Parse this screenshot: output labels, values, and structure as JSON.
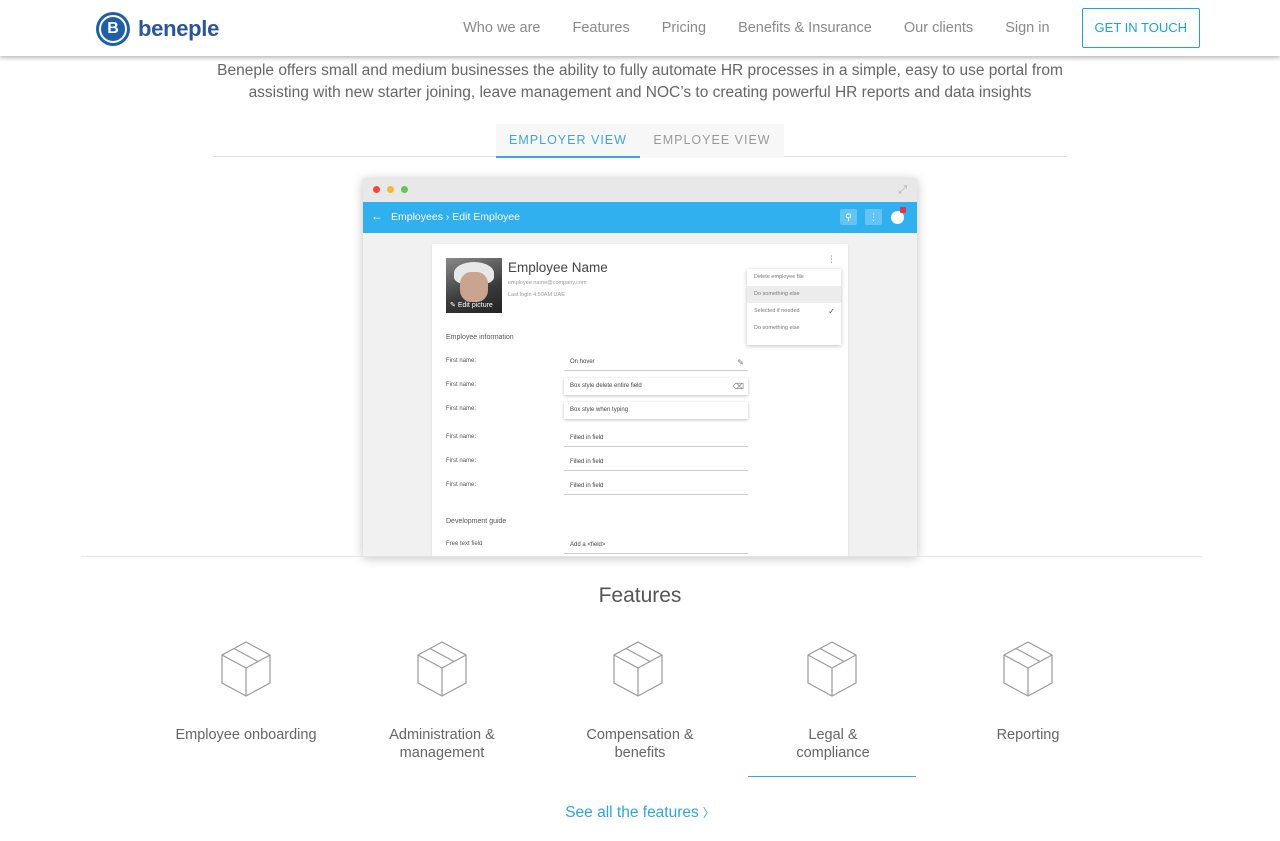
{
  "brand": {
    "name": "beneple",
    "mark": "B"
  },
  "nav": {
    "links": [
      "Who we are",
      "Features",
      "Pricing",
      "Benefits & Insurance",
      "Our clients",
      "Sign in"
    ],
    "cta": "GET IN TOUCH"
  },
  "intro": "Beneple offers small and medium businesses the ability to fully automate HR processes in a simple, easy to use portal from assisting with new starter joining, leave management and NOC’s to creating powerful HR reports and data insights",
  "tabs": [
    {
      "label": "EMPLOYER VIEW",
      "active": true
    },
    {
      "label": "EMPLOYEE VIEW",
      "active": false
    }
  ],
  "mock": {
    "breadcrumb": "Employees  ›  Edit Employee",
    "employee": {
      "name": "Employee Name",
      "email": "employee name@company.com",
      "last_login": "Last login 4:50AM UAE",
      "edit_picture": "Edit picture"
    },
    "dropdown": [
      "Delete employee file",
      "Do something else",
      "Selected if needed",
      "Do something else"
    ],
    "section_info": "Employee information",
    "fields": [
      {
        "label": "First name:",
        "value": "On hover"
      },
      {
        "label": "First name:",
        "value": "Box style delete entire field"
      },
      {
        "label": "First name:",
        "value": "Box style when typing"
      },
      {
        "label": "First name:",
        "value": "Filled in field"
      },
      {
        "label": "First name:",
        "value": "Filled in field"
      },
      {
        "label": "First name:",
        "value": "Filled in field"
      }
    ],
    "section_dev": "Development guide",
    "free_text": {
      "label": "Free text field",
      "value": "Add a <field>"
    }
  },
  "features": {
    "title": "Features",
    "items": [
      {
        "label": "Employee onboarding",
        "icon": "box-icon"
      },
      {
        "label": "Administration & management",
        "icon": "box-icon"
      },
      {
        "label": "Compensation & benefits",
        "icon": "box-icon"
      },
      {
        "label": "Legal & compliance",
        "icon": "box-icon",
        "active": true
      },
      {
        "label": "Reporting",
        "icon": "box-icon"
      }
    ],
    "see_all": "See all the features",
    "see_all_chevron": "〉"
  },
  "colors": {
    "accent": "#3aa6dc",
    "brand": "#2b5797",
    "header": "#31b0ef"
  }
}
